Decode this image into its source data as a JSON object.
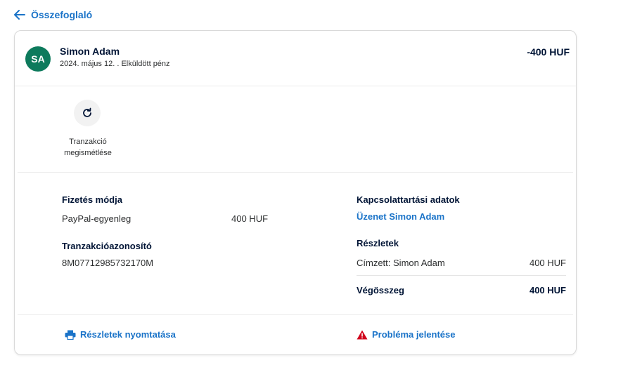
{
  "nav": {
    "back_label": "Összefoglaló"
  },
  "header": {
    "avatar_initials": "SA",
    "name": "Simon Adam",
    "subline": "2024. május 12. . Elküldött pénz",
    "amount": "-400 HUF"
  },
  "actions": {
    "repeat_label": "Tranzakció megismétlése"
  },
  "payment": {
    "heading": "Fizetés módja",
    "method": "PayPal-egyenleg",
    "amount": "400 HUF",
    "txn_heading": "Tranzakcióazonosító",
    "txn_id": "8M07712985732170M"
  },
  "contact": {
    "heading": "Kapcsolattartási adatok",
    "message_link": "Üzenet Simon Adam"
  },
  "details": {
    "heading": "Részletek",
    "recipient_label": "Címzett: Simon Adam",
    "recipient_amount": "400 HUF",
    "total_label": "Végösszeg",
    "total_amount": "400 HUF"
  },
  "footer": {
    "print_label": "Részletek nyomtatása",
    "report_label": "Probléma jelentése"
  },
  "colors": {
    "accent": "#1a73c8",
    "avatar": "#0d7a5c",
    "warning": "#d0021b"
  }
}
